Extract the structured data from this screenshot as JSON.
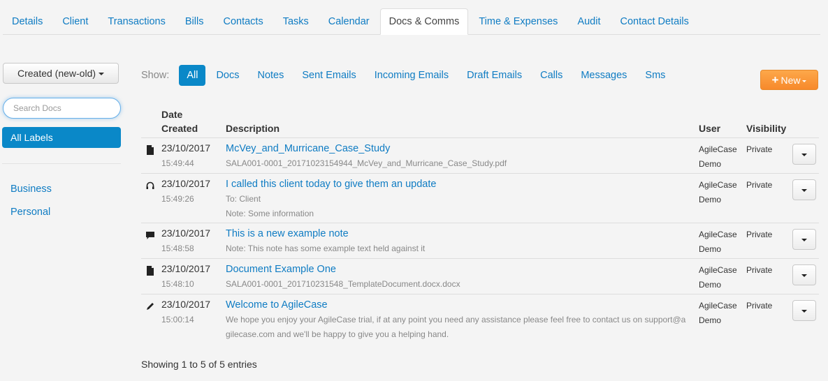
{
  "tabs": [
    {
      "label": "Details",
      "active": false
    },
    {
      "label": "Client",
      "active": false
    },
    {
      "label": "Transactions",
      "active": false
    },
    {
      "label": "Bills",
      "active": false
    },
    {
      "label": "Contacts",
      "active": false
    },
    {
      "label": "Tasks",
      "active": false
    },
    {
      "label": "Calendar",
      "active": false
    },
    {
      "label": "Docs & Comms",
      "active": true
    },
    {
      "label": "Time & Expenses",
      "active": false
    },
    {
      "label": "Audit",
      "active": false
    },
    {
      "label": "Contact Details",
      "active": false
    }
  ],
  "sidebar": {
    "sort_label": "Created (new-old)",
    "search_placeholder": "Search Docs",
    "search_value": "",
    "all_labels": "All Labels",
    "labels": [
      "Business",
      "Personal"
    ]
  },
  "filters": {
    "show_label": "Show:",
    "items": [
      {
        "label": "All",
        "active": true
      },
      {
        "label": "Docs",
        "active": false
      },
      {
        "label": "Notes",
        "active": false
      },
      {
        "label": "Sent Emails",
        "active": false
      },
      {
        "label": "Incoming Emails",
        "active": false
      },
      {
        "label": "Draft Emails",
        "active": false
      },
      {
        "label": "Calls",
        "active": false
      },
      {
        "label": "Messages",
        "active": false
      },
      {
        "label": "Sms",
        "active": false
      }
    ]
  },
  "new_button": {
    "icon": "plus-icon",
    "label": "New"
  },
  "table": {
    "headers": {
      "date_line1": "Date",
      "date_line2": "Created",
      "description": "Description",
      "user": "User",
      "visibility": "Visibility"
    },
    "rows": [
      {
        "icon": "document-icon",
        "date": "23/10/2017",
        "time": "15:49:44",
        "title": "McVey_and_Murricane_Case_Study",
        "sub": [
          "SALA001-0001_20171023154944_McVey_and_Murricane_Case_Study.pdf"
        ],
        "user_line1": "AgileCase",
        "user_line2": "Demo",
        "visibility": "Private"
      },
      {
        "icon": "headphones-icon",
        "date": "23/10/2017",
        "time": "15:49:26",
        "title": "I called this client today to give them an update",
        "sub": [
          "To: Client",
          "Note: Some information"
        ],
        "user_line1": "AgileCase",
        "user_line2": "Demo",
        "visibility": "Private"
      },
      {
        "icon": "comment-icon",
        "date": "23/10/2017",
        "time": "15:48:58",
        "title": "This is a new example note",
        "sub": [
          "Note: This note has some example text held against it"
        ],
        "user_line1": "AgileCase",
        "user_line2": "Demo",
        "visibility": "Private"
      },
      {
        "icon": "document-icon",
        "date": "23/10/2017",
        "time": "15:48:10",
        "title": "Document Example One",
        "sub": [
          "SALA001-0001_201710231548_TemplateDocument.docx.docx"
        ],
        "user_line1": "AgileCase",
        "user_line2": "Demo",
        "visibility": "Private"
      },
      {
        "icon": "pencil-icon",
        "date": "23/10/2017",
        "time": "15:00:14",
        "title": "Welcome to AgileCase",
        "sub": [
          "We hope you enjoy your AgileCase trial, if at any point you need any assistance please feel free to contact us on support@a",
          "gilecase.com and we'll be happy to give you a helping hand."
        ],
        "user_line1": "AgileCase",
        "user_line2": "Demo",
        "visibility": "Private"
      }
    ]
  },
  "footer": "Showing 1 to 5 of 5 entries",
  "colors": {
    "link": "#0f7cc3",
    "active_blue": "#0a88c8",
    "new_orange": "#f7892b",
    "background": "#f4f4f4"
  }
}
